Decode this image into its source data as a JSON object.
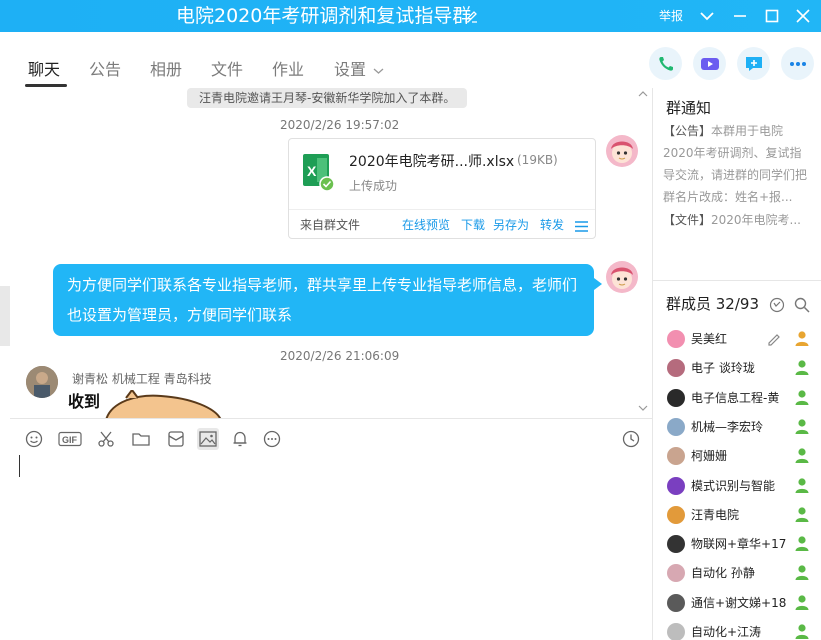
{
  "window": {
    "title": "电院2020年考研调剂和复试指导群",
    "report_label": "举报"
  },
  "tabs": [
    "聊天",
    "公告",
    "相册",
    "文件",
    "作业",
    "设置"
  ],
  "chat": {
    "system_message": "汪青电院邀请王月琴-安徽新华学院加入了本群。",
    "time1": "2020/2/26 19:57:02",
    "file": {
      "name": "2020年电院考研...师.xlsx",
      "size": "(19KB)",
      "status": "上传成功",
      "source": "来自群文件",
      "actions": [
        "在线预览",
        "下载",
        "另存为",
        "转发"
      ]
    },
    "bubble_text": "为方便同学们联系各专业指导老师，群共享里上传专业指导老师信息，老师们也设置为管理员，方便同学们联系",
    "time2": "2020/2/26 21:06:09",
    "sender_name": "谢青松 机械工程 青岛科技",
    "sticker_text": "收到"
  },
  "notice": {
    "title": "群通知",
    "announcement_tag": "【公告】",
    "announcement_text": "本群用于电院2020年考研调剂、复试指导交流，请进群的同学们把群名片改成：姓名+报...",
    "file_tag": "【文件】",
    "file_text": "2020年电院考..."
  },
  "members": {
    "title": "群成员 32/93",
    "list": [
      {
        "name": "吴美红",
        "color": "#f28fb0",
        "owner": true
      },
      {
        "name": "电子    谈玲珑",
        "color": "#b56b7d"
      },
      {
        "name": "电子信息工程-黄",
        "color": "#2a2a2a"
      },
      {
        "name": "机械—李宏玲",
        "color": "#8aa9c8"
      },
      {
        "name": "柯姗姗",
        "color": "#c9a48f"
      },
      {
        "name": "模式识别与智能",
        "color": "#7a3fc0"
      },
      {
        "name": "汪青电院",
        "color": "#e29a3a"
      },
      {
        "name": "物联网+章华+17",
        "color": "#333333"
      },
      {
        "name": "自动化  孙静",
        "color": "#d7a8b2"
      },
      {
        "name": "通信+谢文娣+18",
        "color": "#5a5a5a"
      },
      {
        "name": "自动化+江涛",
        "color": "#bdbdbd"
      }
    ]
  }
}
